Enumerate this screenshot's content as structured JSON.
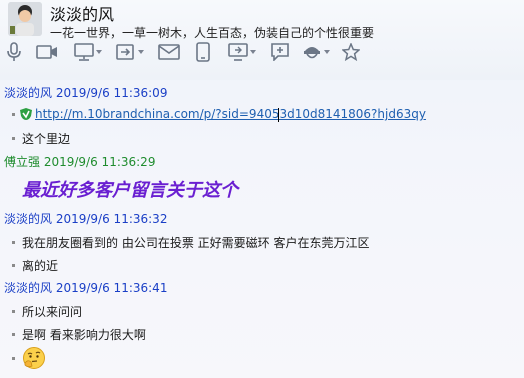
{
  "header": {
    "name": "淡淡的风",
    "signature": "一花一世界，一草一树木，人生百态，伪装自己的个性很重要"
  },
  "toolbar": {
    "items": [
      {
        "icon": "microphone-icon"
      },
      {
        "icon": "video-camera-icon"
      },
      {
        "icon": "remote-desktop-icon",
        "dropdown": true
      },
      {
        "icon": "transfer-file-icon",
        "dropdown": true
      },
      {
        "icon": "email-icon"
      },
      {
        "icon": "mobile-phone-icon"
      },
      {
        "icon": "screen-share-icon",
        "dropdown": true
      },
      {
        "icon": "add-app-icon"
      },
      {
        "icon": "assistant-icon",
        "dropdown": true
      },
      {
        "icon": "star-icon"
      }
    ]
  },
  "messages": [
    {
      "sender": "淡淡的风",
      "time": "2019/9/6 11:36:09",
      "color": "#1a3fc6",
      "lines": [
        {
          "type": "link",
          "text": "http://m.10brandchina.com/p/?sid=94053d10d8141806?hjd63qy"
        },
        {
          "type": "text",
          "text": "这个里边"
        }
      ]
    },
    {
      "sender": "傅立强",
      "time": "2019/9/6 11:36:29",
      "color": "#1f8c2e",
      "lines": [
        {
          "type": "big",
          "text": "最近好多客户留言关于这个"
        }
      ]
    },
    {
      "sender": "淡淡的风",
      "time": "2019/9/6 11:36:32",
      "color": "#1a3fc6",
      "lines": [
        {
          "type": "text",
          "text": "我在朋友圈看到的 由公司在投票 正好需要磁环 客户在东莞万江区"
        },
        {
          "type": "text",
          "text": "离的近"
        }
      ]
    },
    {
      "sender": "淡淡的风",
      "time": "2019/9/6 11:36:41",
      "color": "#1a3fc6",
      "lines": [
        {
          "type": "text",
          "text": "所以来问问"
        },
        {
          "type": "text",
          "text": "是啊 看来影响力很大啊"
        },
        {
          "type": "emoji",
          "icon": "thinking-emoji-icon"
        }
      ]
    }
  ]
}
